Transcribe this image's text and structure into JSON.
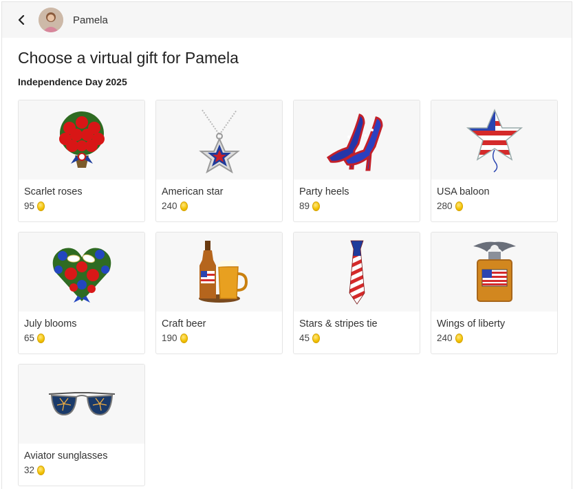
{
  "header": {
    "user_name": "Pamela"
  },
  "page": {
    "title": "Choose a virtual gift for Pamela",
    "section": "Independence Day 2025"
  },
  "gifts": [
    {
      "name": "Scarlet roses",
      "price": "95",
      "icon": "roses-bouquet-icon"
    },
    {
      "name": "American star",
      "price": "240",
      "icon": "star-pendant-icon"
    },
    {
      "name": "Party heels",
      "price": "89",
      "icon": "heels-icon"
    },
    {
      "name": "USA baloon",
      "price": "280",
      "icon": "star-balloon-icon"
    },
    {
      "name": "July blooms",
      "price": "65",
      "icon": "heart-bouquet-icon"
    },
    {
      "name": "Craft beer",
      "price": "190",
      "icon": "beer-icon"
    },
    {
      "name": "Stars & stripes tie",
      "price": "45",
      "icon": "tie-icon"
    },
    {
      "name": "Wings of liberty",
      "price": "240",
      "icon": "perfume-icon"
    },
    {
      "name": "Aviator sunglasses",
      "price": "32",
      "icon": "sunglasses-icon"
    }
  ],
  "colors": {
    "coin": "#f2c200",
    "header_bg": "#f6f6f6",
    "card_thumb_bg": "#f7f7f7"
  }
}
